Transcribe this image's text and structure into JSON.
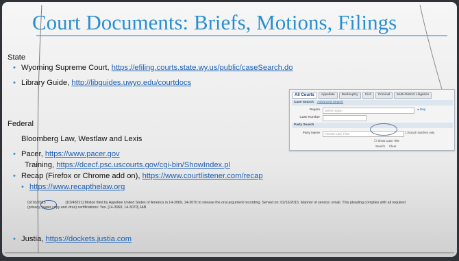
{
  "title": "Court Documents: Briefs, Motions, Filings",
  "state": {
    "heading": "State",
    "items": [
      {
        "label": "Wyoming Supreme Court, ",
        "url": "https://efiling.courts.state.wy.us/public/caseSearch.do"
      },
      {
        "label": "Library Guide, ",
        "url": "http://libguides.uwyo.edu/courtdocs"
      }
    ]
  },
  "federal": {
    "heading": "Federal",
    "items": [
      {
        "label": "Bloomberg Law, Westlaw and Lexis"
      },
      {
        "label": "Pacer, ",
        "url": "https://www.pacer.gov"
      },
      {
        "label": "Training, ",
        "url": "https://dcecf.psc.uscourts.gov/cgi-bin/ShowIndex.pl"
      },
      {
        "label": "Recap (Firefox or Chrome add on), ",
        "url": "https://www.courtlistener.com/recap"
      },
      {
        "url": "https://www.recapthelaw.org"
      },
      {
        "label": "Justia, ",
        "url": "https://dockets.justia.com"
      }
    ]
  },
  "search_panel": {
    "tabs": [
      "All Courts",
      "Appellate",
      "Bankruptcy",
      "Civil",
      "Criminal",
      "Multi-District Litigation"
    ],
    "case_search": "Case Search",
    "advanced": "Advanced Search",
    "region_label": "Region",
    "region_placeholder": "Select region",
    "map": "Map",
    "case_number_label": "Case Number",
    "party_search": "Party Search",
    "party_name_label": "Party Name",
    "party_placeholder": "Format: Last, First",
    "exact": "Exact matches only",
    "show_case_title": "Show Case Title",
    "search": "Search",
    "clear": "Clear"
  },
  "docket": {
    "date": "02/16/2015",
    "text": "[10248221] Motion filed by Appellee United States of America in 14-3069, 14-3070 to release the oral argument recording. Served on: 02/16/2015. Manner of service: email. This pleading complies with all required (privacy, paper copy and virus) certifications: Yes. [14-3069, 14-3070] JAB"
  }
}
